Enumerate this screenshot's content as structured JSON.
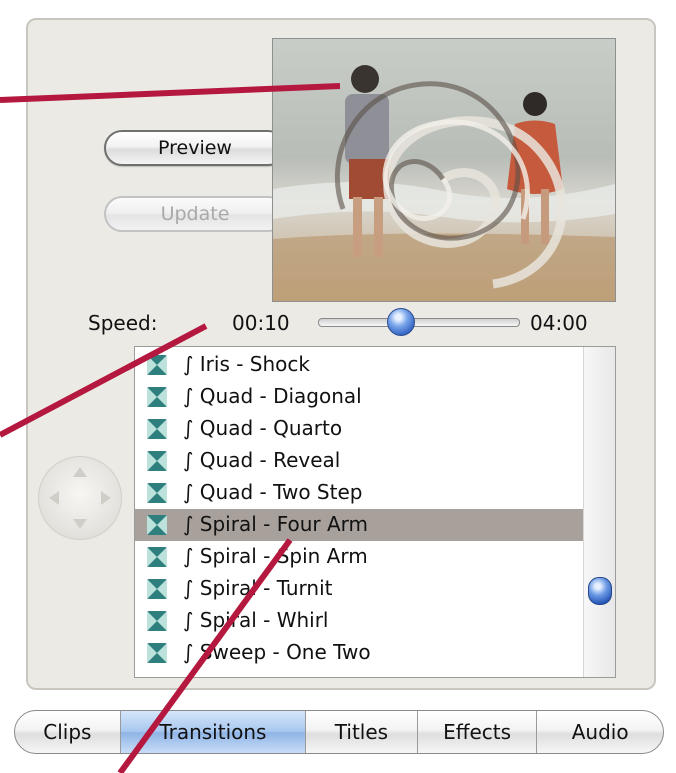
{
  "buttons": {
    "preview_label": "Preview",
    "update_label": "Update"
  },
  "speed": {
    "label": "Speed:",
    "min": "00:10",
    "max": "04:00",
    "slider_fraction": 0.41
  },
  "transitions": [
    {
      "label": "∫ Iris - Shock",
      "selected": false
    },
    {
      "label": "∫ Quad - Diagonal",
      "selected": false
    },
    {
      "label": "∫ Quad - Quarto",
      "selected": false
    },
    {
      "label": "∫ Quad - Reveal",
      "selected": false
    },
    {
      "label": "∫ Quad - Two Step",
      "selected": false
    },
    {
      "label": "∫ Spiral - Four Arm",
      "selected": true
    },
    {
      "label": "∫ Spiral - Spin Arm",
      "selected": false
    },
    {
      "label": "∫ Spiral - Turnit",
      "selected": false
    },
    {
      "label": "∫ Spiral - Whirl",
      "selected": false
    },
    {
      "label": "∫ Sweep - One Two",
      "selected": false
    }
  ],
  "tabs": [
    {
      "label": "Clips",
      "active": false
    },
    {
      "label": "Transitions",
      "active": true
    },
    {
      "label": "Titles",
      "active": false
    },
    {
      "label": "Effects",
      "active": false
    },
    {
      "label": "Audio",
      "active": false
    }
  ],
  "colors": {
    "callout_line": "#b5183f",
    "selection": "#a8a19b",
    "active_tab": "#a9c8ef"
  },
  "icons": {
    "transition_row": "transition-icon",
    "nav_pad": "direction-pad-icon"
  }
}
